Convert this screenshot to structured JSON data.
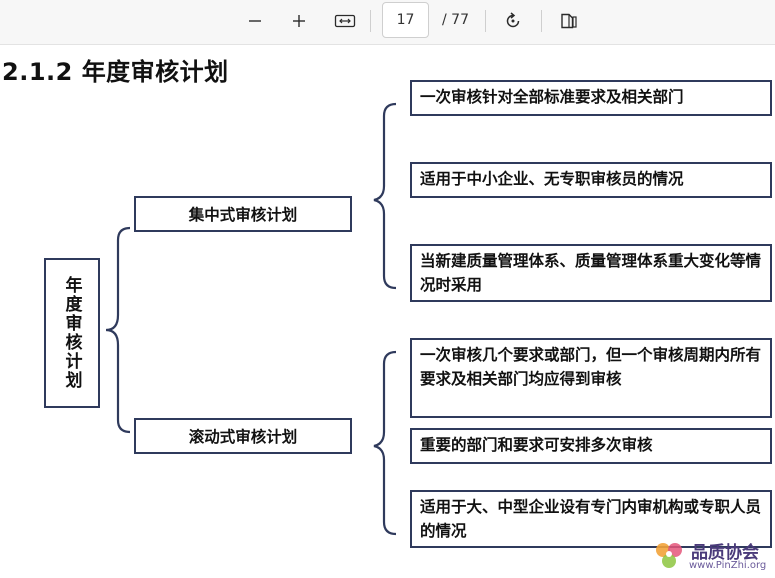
{
  "toolbar": {
    "current_page": "17",
    "page_total": "/ 77",
    "icons": [
      "zoom-out-icon",
      "zoom-in-icon",
      "fit-width-icon",
      "rotate-icon",
      "page-view-icon"
    ]
  },
  "document": {
    "heading": "2.1.2 年度审核计划",
    "root": "年度审核计划",
    "centralized": {
      "label": "集中式审核计划",
      "items": [
        "一次审核针对全部标准要求及相关部门",
        "适用于中小企业、无专职审核员的情况",
        "当新建质量管理体系、质量管理体系重大变化等情况时采用"
      ]
    },
    "rolling": {
      "label": "滚动式审核计划",
      "items": [
        "一次审核几个要求或部门，但一个审核周期内所有要求及相关部门均应得到审核",
        "重要的部门和要求可安排多次审核",
        "适用于大、中型企业设有专门内审机构或专职人员的情况"
      ]
    },
    "colors": {
      "border": "#2f3a5c",
      "brace": "#2f3a5c"
    }
  },
  "watermark": {
    "text": "品质协会",
    "url": "www.PinZhi.org"
  }
}
